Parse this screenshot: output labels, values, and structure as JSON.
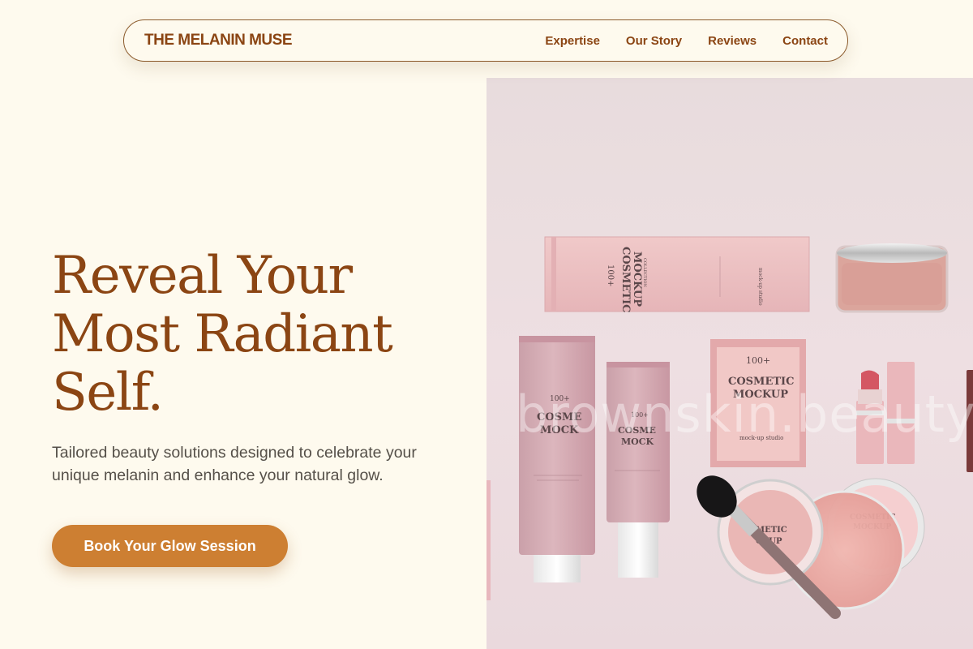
{
  "nav": {
    "brand": "THE MELANIN MUSE",
    "links": [
      "Expertise",
      "Our Story",
      "Reviews",
      "Contact"
    ]
  },
  "hero": {
    "headline_lines": [
      "Reveal Your",
      "Most Radiant",
      "Self."
    ],
    "subtitle": "Tailored beauty solutions designed to celebrate your unique melanin and enhance your natural glow.",
    "cta_label": "Book Your Glow Session"
  },
  "image": {
    "watermark": "brownskin.beauty",
    "product_text": {
      "brand_mark": "100+",
      "title_1": "COSMETIC",
      "title_2": "MOCKUP",
      "collection": "COLLECTION",
      "studio": "mock-up studio",
      "by": "BY ☀ PREVIEW",
      "jar_title_1": "COSMETIC",
      "jar_title_2": "MOCKUP"
    }
  },
  "colors": {
    "background": "#fefaee",
    "brand_brown": "#8b4513",
    "cta_orange": "#cd7f32",
    "body_text": "#555049",
    "product_pink": "#e9b9bd"
  }
}
